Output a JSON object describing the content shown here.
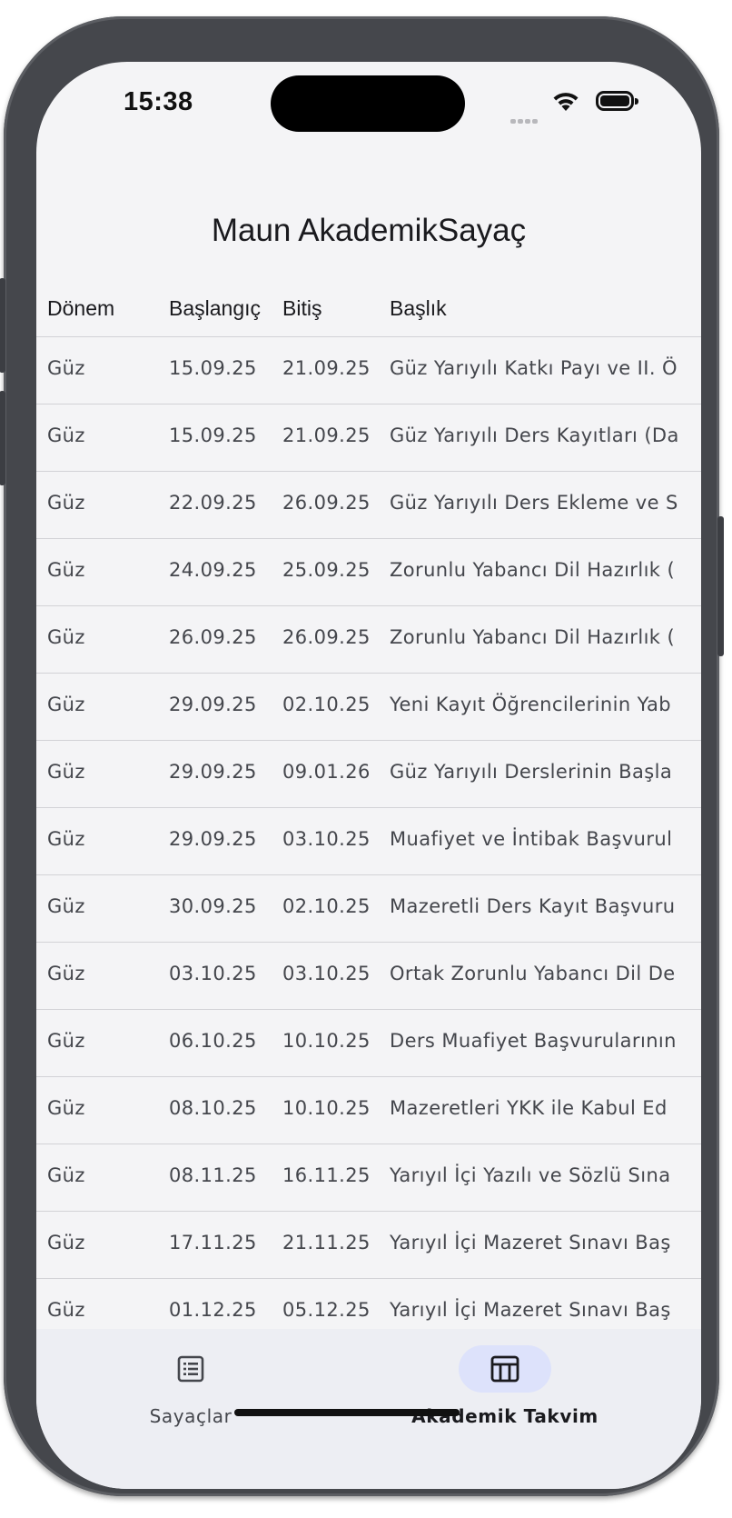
{
  "status_bar": {
    "time": "15:38"
  },
  "app": {
    "title": "Maun AkademikSayaç"
  },
  "table": {
    "headers": [
      "Dönem",
      "Başlangıç",
      "Bitiş",
      "Başlık"
    ],
    "rows": [
      {
        "term": "Güz",
        "start": "15.09.25",
        "end": "21.09.25",
        "title": "Güz Yarıyılı Katkı Payı ve II. Ö"
      },
      {
        "term": "Güz",
        "start": "15.09.25",
        "end": "21.09.25",
        "title": "Güz Yarıyılı Ders Kayıtları (Da"
      },
      {
        "term": "Güz",
        "start": "22.09.25",
        "end": "26.09.25",
        "title": "Güz Yarıyılı Ders Ekleme ve S"
      },
      {
        "term": "Güz",
        "start": "24.09.25",
        "end": "25.09.25",
        "title": "Zorunlu Yabancı Dil Hazırlık ("
      },
      {
        "term": "Güz",
        "start": "26.09.25",
        "end": "26.09.25",
        "title": "Zorunlu Yabancı Dil Hazırlık ("
      },
      {
        "term": "Güz",
        "start": "29.09.25",
        "end": "02.10.25",
        "title": "Yeni Kayıt Öğrencilerinin Yab"
      },
      {
        "term": "Güz",
        "start": "29.09.25",
        "end": "09.01.26",
        "title": "Güz Yarıyılı Derslerinin Başla"
      },
      {
        "term": "Güz",
        "start": "29.09.25",
        "end": "03.10.25",
        "title": "Muafiyet ve İntibak Başvurul"
      },
      {
        "term": "Güz",
        "start": "30.09.25",
        "end": "02.10.25",
        "title": "Mazeretli Ders Kayıt Başvuru"
      },
      {
        "term": "Güz",
        "start": "03.10.25",
        "end": "03.10.25",
        "title": "Ortak Zorunlu Yabancı Dil De"
      },
      {
        "term": "Güz",
        "start": "06.10.25",
        "end": "10.10.25",
        "title": "Ders Muafiyet Başvurularının"
      },
      {
        "term": "Güz",
        "start": "08.10.25",
        "end": "10.10.25",
        "title": "Mazeretleri YKK ile Kabul Ed"
      },
      {
        "term": "Güz",
        "start": "08.11.25",
        "end": "16.11.25",
        "title": "Yarıyıl İçi Yazılı ve Sözlü Sına"
      },
      {
        "term": "Güz",
        "start": "17.11.25",
        "end": "21.11.25",
        "title": "Yarıyıl İçi Mazeret Sınavı Baş"
      },
      {
        "term": "Güz",
        "start": "01.12.25",
        "end": "05.12.25",
        "title": "Yarıyıl İçi Mazeret Sınavı Baş"
      }
    ]
  },
  "bottom_nav": {
    "items": [
      {
        "label": "Sayaçlar",
        "icon": "list-icon",
        "active": false
      },
      {
        "label": "Akademik Takvim",
        "icon": "calendar-table-icon",
        "active": true
      }
    ]
  },
  "colors": {
    "screen_bg": "#f4f4f6",
    "nav_bg": "#edeef3",
    "active_pill": "#dde2fb",
    "text_primary": "#1a1a1e",
    "text_secondary": "#44464c",
    "divider": "#d2d2d6"
  }
}
